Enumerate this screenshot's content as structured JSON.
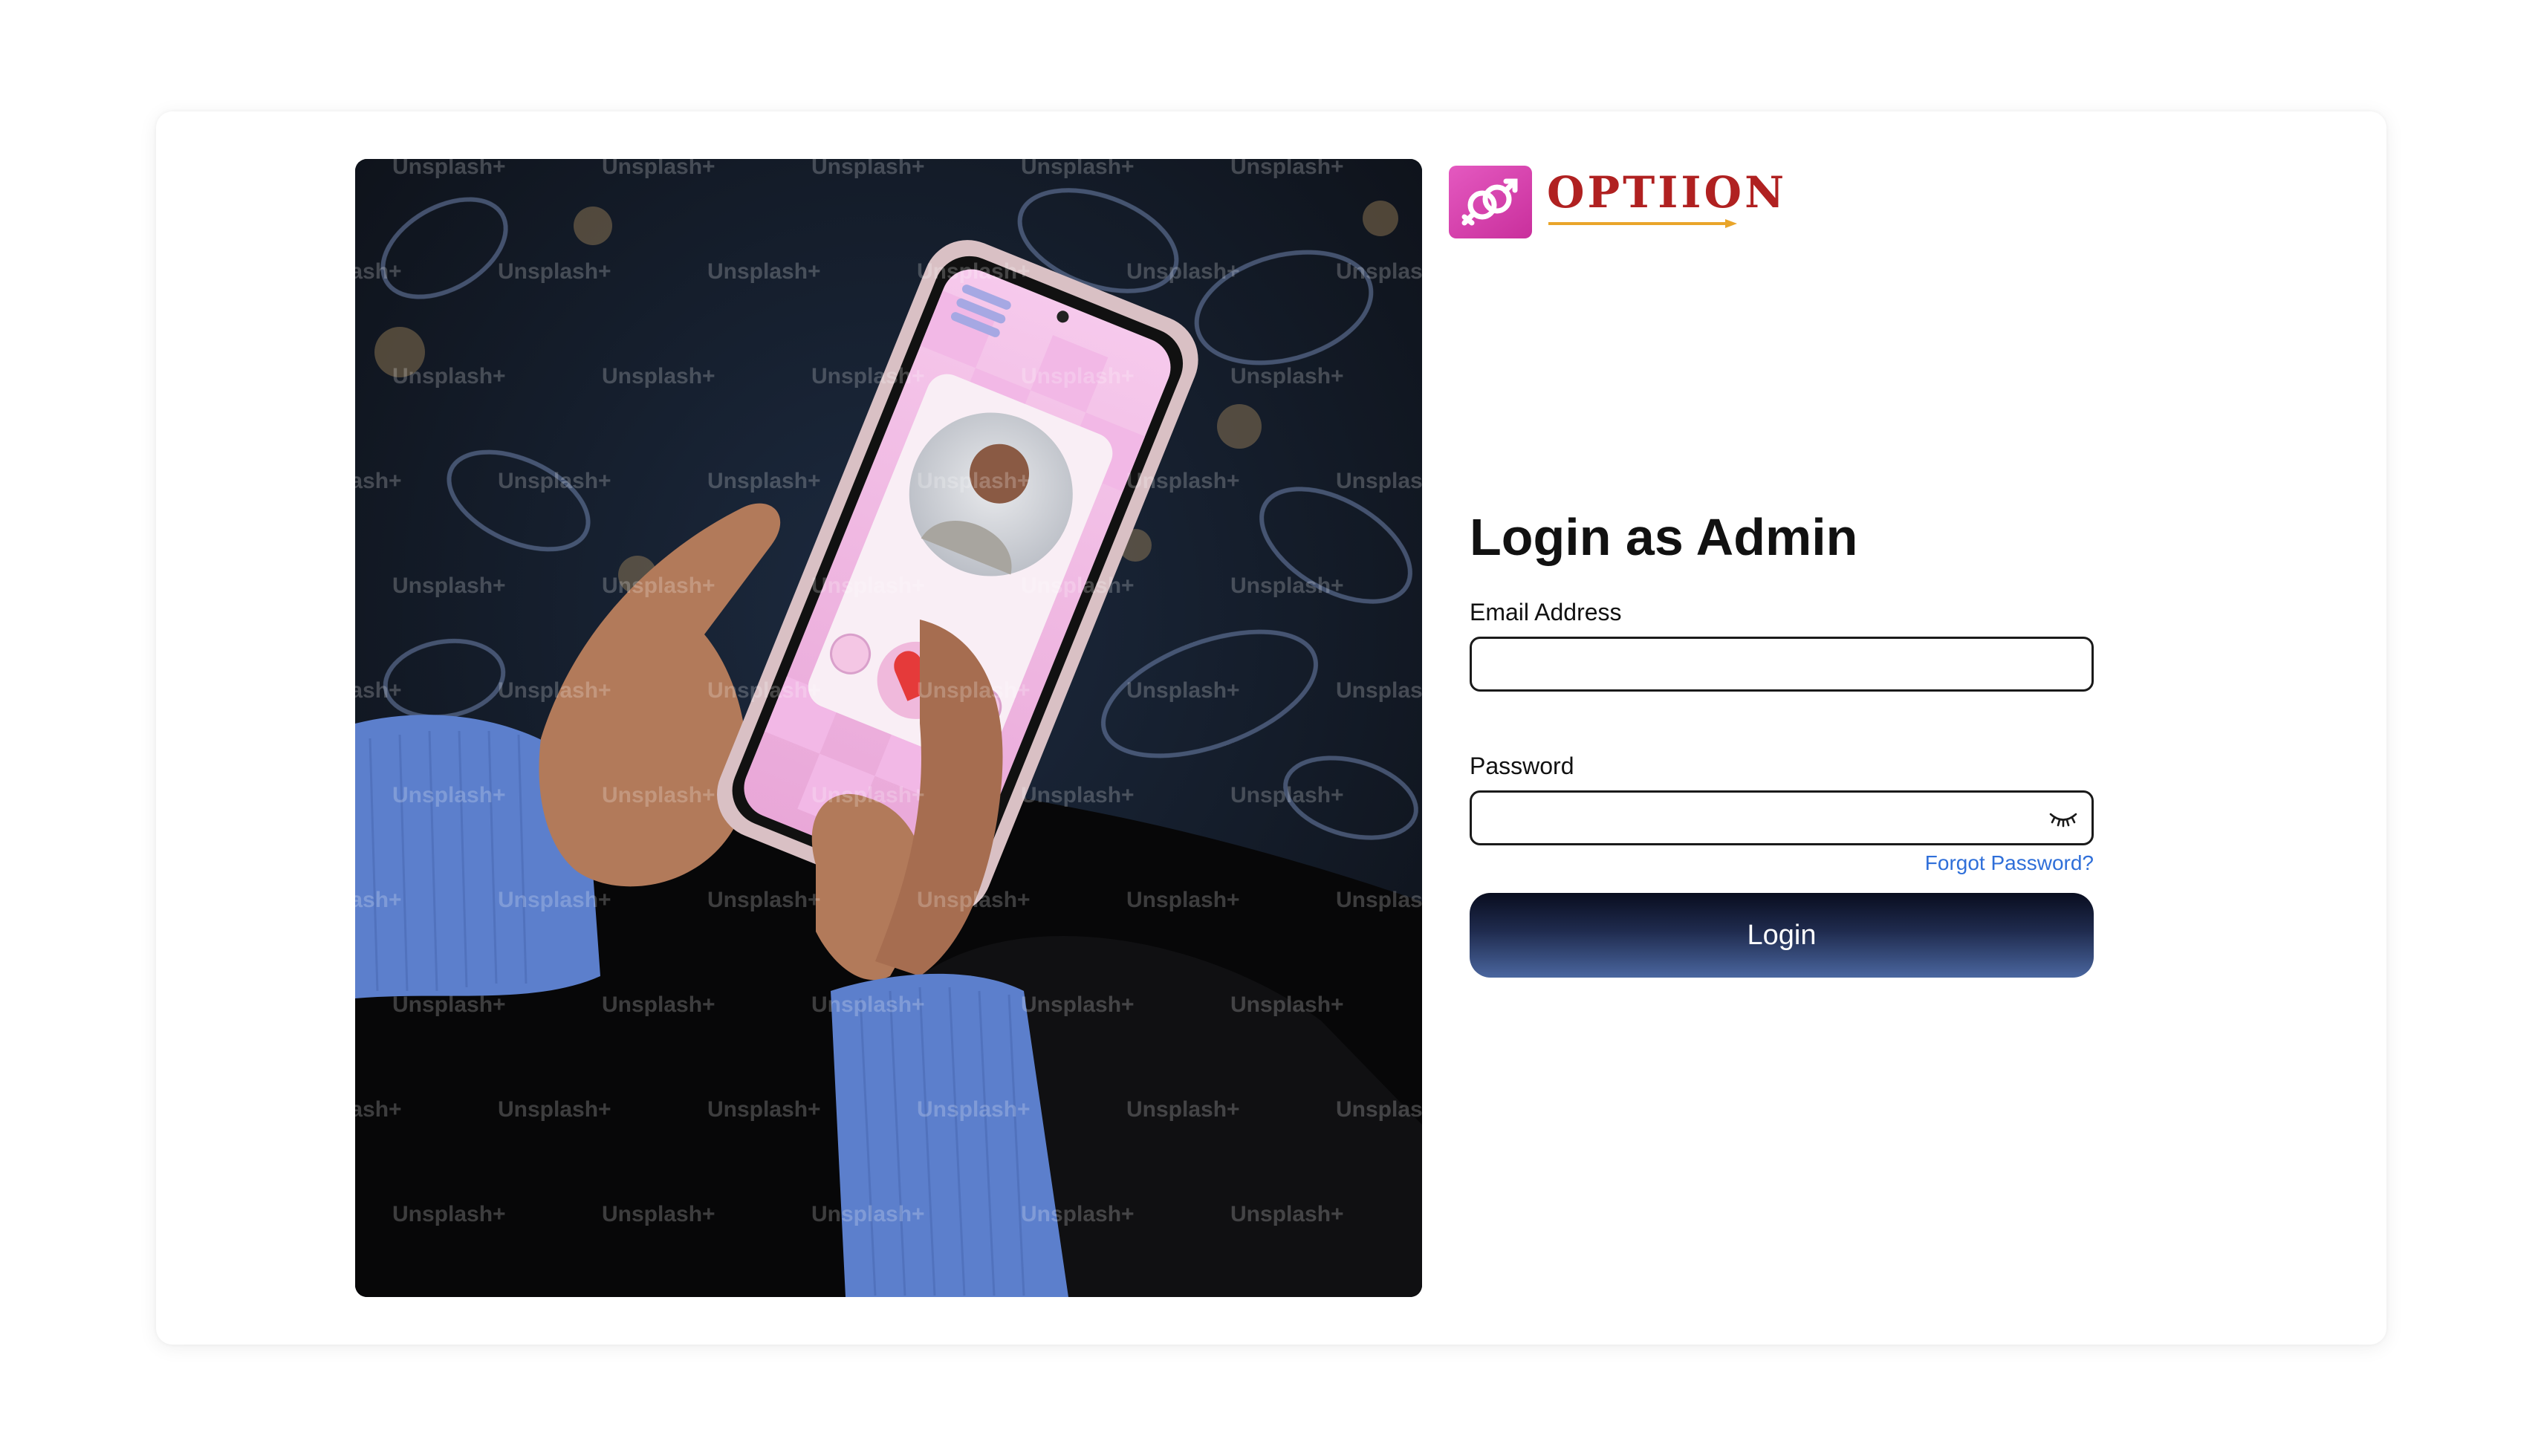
{
  "brand": {
    "name": "OPTIION",
    "logo_icon": "gender-symbols-icon",
    "badge_color": "#d43fab",
    "text_color": "#b02121",
    "arrow_color": "#e9a52a"
  },
  "hero": {
    "watermark": "Unsplash+"
  },
  "form": {
    "title": "Login as Admin",
    "email_label": "Email Address",
    "email_value": "",
    "password_label": "Password",
    "password_value": "",
    "password_toggle_icon": "eye-closed-icon",
    "forgot_label": "Forgot Password?",
    "login_label": "Login"
  },
  "colors": {
    "link": "#2f6fd9",
    "button_top": "#090d1f",
    "button_bottom": "#4a669f"
  }
}
